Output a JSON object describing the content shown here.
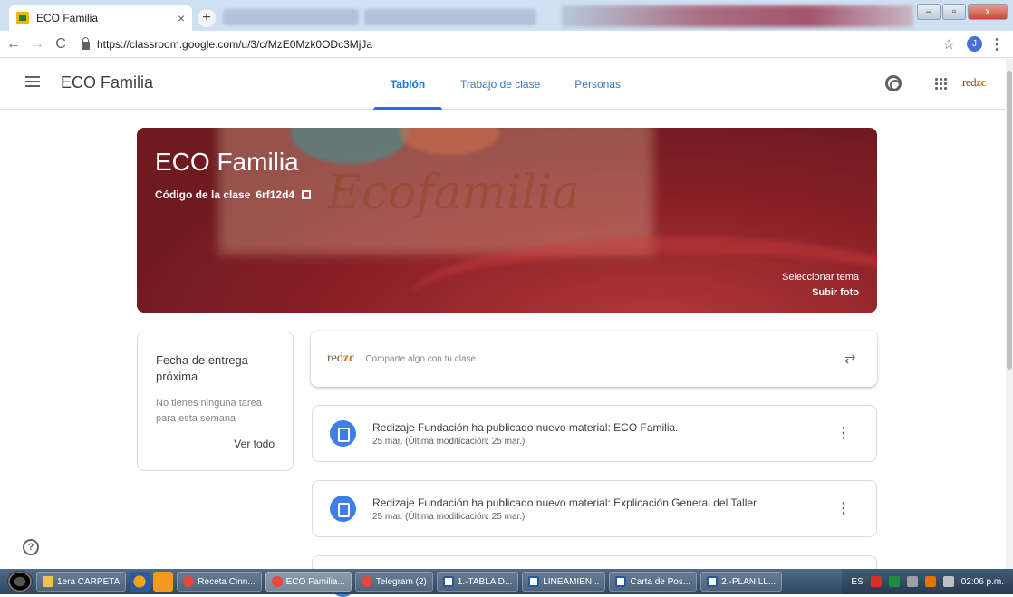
{
  "browser": {
    "tab_title": "ECO Familia",
    "tab_close": "×",
    "new_tab": "+",
    "url": "https://classroom.google.com/u/3/c/MzE0Mzk0ODc3MjJa",
    "profile_initial": "J",
    "window_buttons": [
      "–",
      "▫",
      "x"
    ]
  },
  "appbar": {
    "title": "ECO Familia",
    "tabs": [
      {
        "label": "Tablón",
        "active": true
      },
      {
        "label": "Trabajo de clase",
        "active": false
      },
      {
        "label": "Personas",
        "active": false
      }
    ],
    "logo_text_a": "red",
    "logo_text_b": "zc"
  },
  "banner": {
    "title": "ECO Familia",
    "code_label": "Código de la clase",
    "code": "6rf12d4",
    "watermark": "Ecofamilia",
    "select_theme": "Seleccionar tema",
    "upload_photo": "Subir foto",
    "colors": {
      "base": "#8e2228",
      "accent": "#b33a3a"
    }
  },
  "upcoming": {
    "title": "Fecha de entrega próxima",
    "empty": "No tienes ninguna tarea para esta semana",
    "view_all": "Ver todo"
  },
  "share": {
    "placeholder": "Comparte algo con tu clase...",
    "logo_a": "red",
    "logo_b": "zc"
  },
  "posts": [
    {
      "title": "Redizaje Fundación ha publicado nuevo material: ECO Familia.",
      "date": "25 mar. (Última modificación: 25 mar.)"
    },
    {
      "title": "Redizaje Fundación ha publicado nuevo material: Explicación General del Taller",
      "date": "25 mar. (Última modificación: 25 mar.)"
    }
  ],
  "help_icon": "?",
  "taskbar": {
    "items": [
      {
        "label": "1era CARPETA",
        "icon": "folder-icon",
        "color": "#f2c14e"
      },
      {
        "label": "Receta Cinn...",
        "icon": "chrome-icon",
        "color": "#e8453c"
      },
      {
        "label": "ECO Familia...",
        "icon": "chrome-icon",
        "color": "#e8453c",
        "active": true
      },
      {
        "label": "Telegram (2)",
        "icon": "chrome-icon",
        "color": "#e8453c"
      },
      {
        "label": "1.-TABLA D...",
        "icon": "word-icon",
        "color": "#2b5797"
      },
      {
        "label": "LINEAMIEN...",
        "icon": "word-icon",
        "color": "#2b5797"
      },
      {
        "label": "Carta de Pos...",
        "icon": "word-icon",
        "color": "#2b5797"
      },
      {
        "label": "2.-PLANILL...",
        "icon": "word-icon",
        "color": "#2b5797"
      }
    ],
    "lang": "ES",
    "clock": "02:06 p.m."
  }
}
